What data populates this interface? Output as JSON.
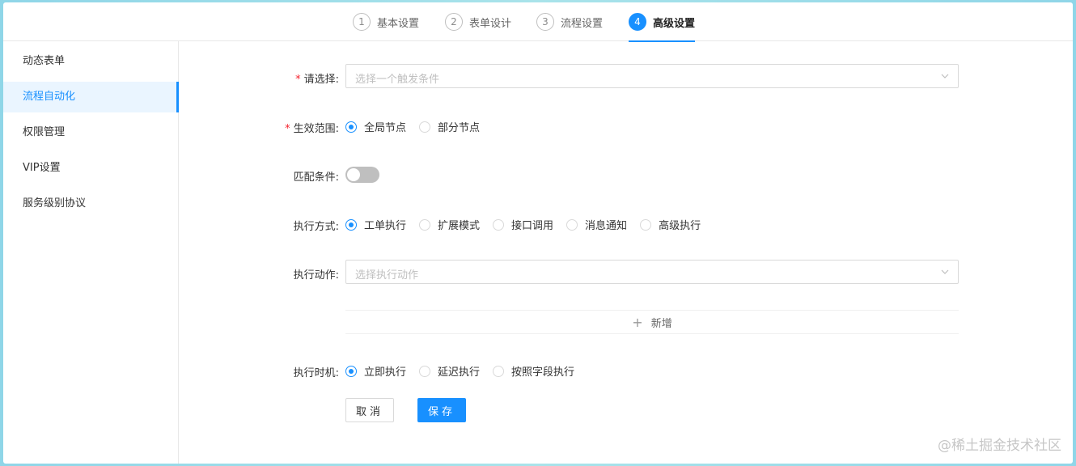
{
  "steps": [
    {
      "num": "1",
      "label": "基本设置"
    },
    {
      "num": "2",
      "label": "表单设计"
    },
    {
      "num": "3",
      "label": "流程设置"
    },
    {
      "num": "4",
      "label": "高级设置"
    }
  ],
  "sidebar": {
    "items": [
      {
        "label": "动态表单"
      },
      {
        "label": "流程自动化"
      },
      {
        "label": "权限管理"
      },
      {
        "label": "VIP设置"
      },
      {
        "label": "服务级别协议"
      }
    ]
  },
  "form": {
    "trigger": {
      "label": "请选择:",
      "placeholder": "选择一个触发条件"
    },
    "scope": {
      "label": "生效范围:",
      "options": [
        "全局节点",
        "部分节点"
      ],
      "selected": "全局节点"
    },
    "match": {
      "label": "匹配条件:",
      "enabled": false
    },
    "exec_mode": {
      "label": "执行方式:",
      "options": [
        "工单执行",
        "扩展模式",
        "接口调用",
        "消息通知",
        "高级执行"
      ],
      "selected": "工单执行"
    },
    "exec_action": {
      "label": "执行动作:",
      "placeholder": "选择执行动作"
    },
    "add": {
      "label": "新增"
    },
    "exec_time": {
      "label": "执行时机:",
      "options": [
        "立即执行",
        "延迟执行",
        "按照字段执行"
      ],
      "selected": "立即执行"
    },
    "cancel_label": "取消",
    "save_label": "保存"
  },
  "watermark": "@稀土掘金技术社区",
  "colors": {
    "accent": "#1890ff",
    "required": "#f5222d"
  }
}
